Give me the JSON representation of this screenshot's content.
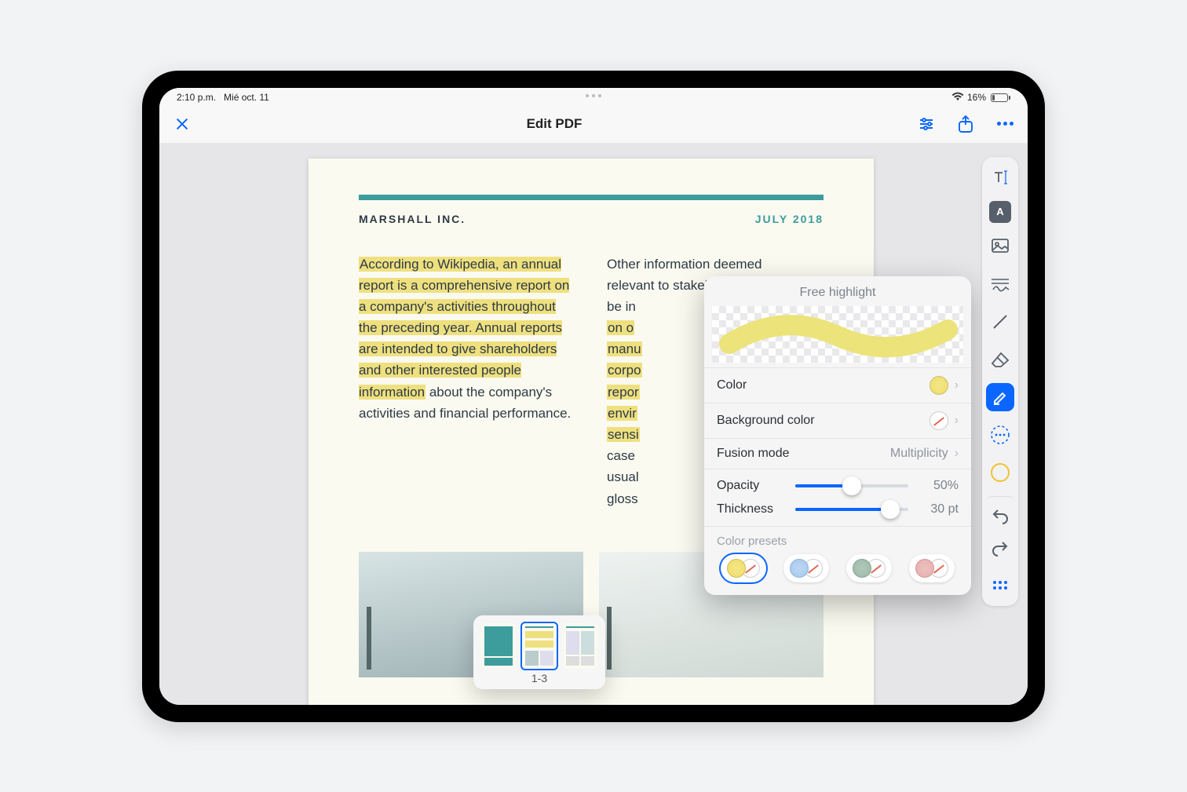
{
  "status": {
    "time": "2:10 p.m.",
    "date": "Mié oct. 11",
    "battery_pct": "16%"
  },
  "toolbar": {
    "title": "Edit PDF"
  },
  "document": {
    "company": "MARSHALL INC.",
    "date": "JULY 2018",
    "col1_highlighted": "According to Wikipedia, an annual report is a comprehensive report on a company's activities throughout the preceding year. Annual reports are intended to give shareholders and other interested people information",
    "col1_plain": " about the company's activities and financial performance.",
    "col2_lines": [
      "Other information deemed",
      "relevant to stakeholders may",
      "be in",
      "on o",
      "manu",
      "corpo",
      "repor",
      "envir",
      "sensi",
      "case",
      "usual",
      "gloss"
    ]
  },
  "thumbs": {
    "range": "1-3"
  },
  "popover": {
    "title": "Free highlight",
    "rows": {
      "color": "Color",
      "background": "Background color",
      "fusion_label": "Fusion mode",
      "fusion_value": "Multiplicity",
      "opacity_label": "Opacity",
      "opacity_value": "50%",
      "thickness_label": "Thickness",
      "thickness_value": "30 pt",
      "presets_label": "Color presets"
    },
    "opacity_pct": 50,
    "thickness_pct": 84,
    "preset_colors": [
      "#f1e474",
      "#a8c8ef",
      "#9db9a8",
      "#e6aeae"
    ]
  },
  "tools": {
    "textbox_label": "A"
  }
}
